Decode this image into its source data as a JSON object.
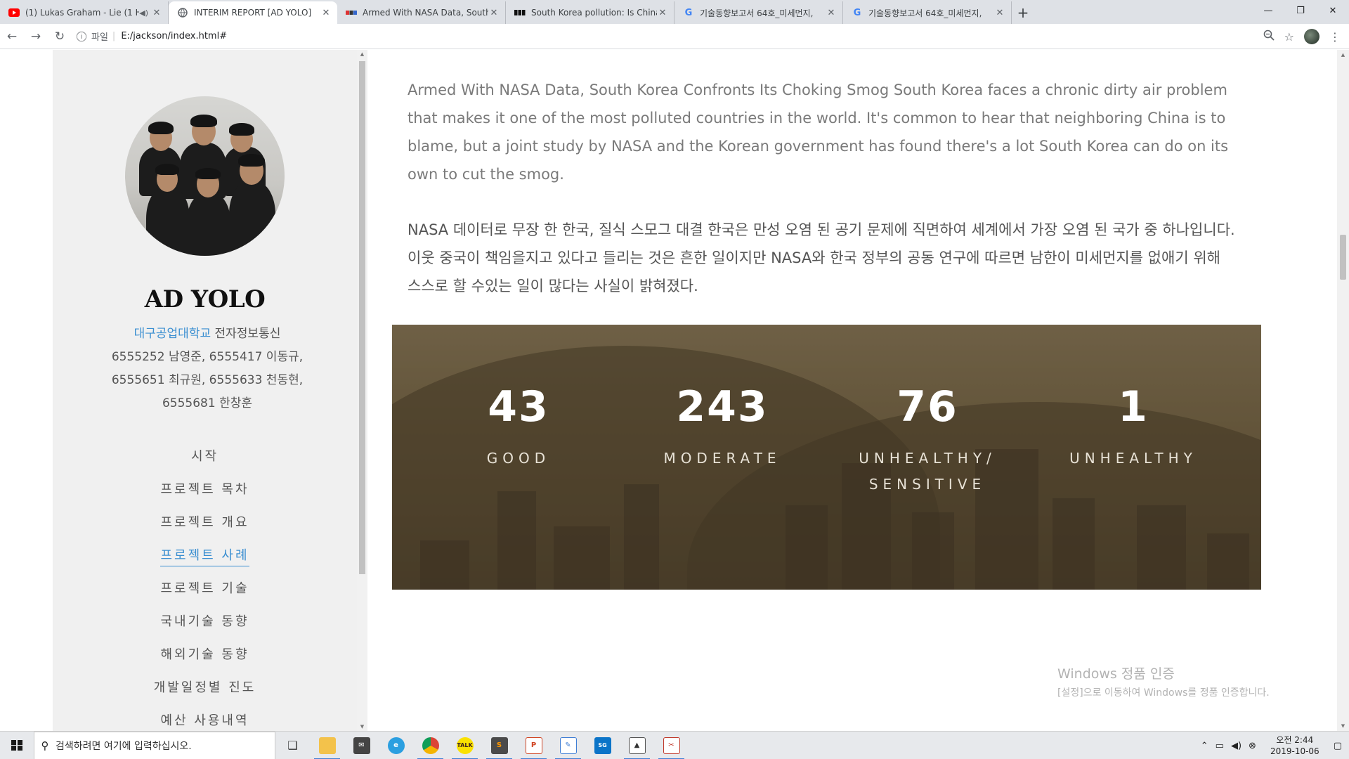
{
  "browser": {
    "tabs": [
      {
        "title": "(1) Lukas Graham - Lie (1 H",
        "icon": "youtube-icon",
        "active": false,
        "audio": true
      },
      {
        "title": "INTERIM REPORT [AD YOLO]",
        "icon": "globe-icon",
        "active": true,
        "audio": false
      },
      {
        "title": "Armed With NASA Data, South",
        "icon": "news-icon",
        "active": false,
        "audio": false
      },
      {
        "title": "South Korea pollution: Is China",
        "icon": "bbc-icon",
        "active": false,
        "audio": false
      },
      {
        "title": "기술동향보고서 64호_미세먼지,",
        "icon": "google-icon",
        "active": false,
        "audio": false
      },
      {
        "title": "기술동향보고서 64호_미세먼지,",
        "icon": "google-icon",
        "active": false,
        "audio": false
      }
    ],
    "address": {
      "scheme_label": "파일",
      "url": "E:/jackson/index.html#"
    }
  },
  "sidebar": {
    "brand": "AD YOLO",
    "school": "대구공업대학교",
    "department": " 전자정보통신",
    "members_line1": "6555252 남영준, 6555417 이동규,",
    "members_line2": "6555651 최규원, 6555633 천동현,",
    "members_line3": "6555681 한창훈",
    "menu": [
      {
        "label": "시작",
        "active": false
      },
      {
        "label": "프로젝트 목차",
        "active": false
      },
      {
        "label": "프로젝트 개요",
        "active": false
      },
      {
        "label": "프로젝트 사례",
        "active": true
      },
      {
        "label": "프로젝트 기술",
        "active": false
      },
      {
        "label": "국내기술 동향",
        "active": false
      },
      {
        "label": "해외기술 동향",
        "active": false
      },
      {
        "label": "개발일정별 진도",
        "active": false
      },
      {
        "label": "예산 사용내역",
        "active": false
      }
    ]
  },
  "main": {
    "paragraph_en": "Armed With NASA Data, South Korea Confronts Its Choking Smog South Korea faces a chronic dirty air problem that makes it one of the most polluted countries in the world. It's common to hear that neighboring China is to blame, but a joint study by NASA and the Korean government has found there's a lot South Korea can do on its own to cut the smog.",
    "paragraph_ko": "NASA 데이터로 무장 한 한국, 질식 스모그 대결 한국은 만성 오염 된 공기 문제에 직면하여 세계에서 가장 오염 된 국가 중 하나입니다. 이웃 중국이 책임을지고 있다고 들리는 것은 흔한 일이지만 NASA와 한국 정부의 공동 연구에 따르면 남한이 미세먼지를 없애기 위해 스스로 할 수있는 일이 많다는 사실이 밝혀졌다.",
    "stats": [
      {
        "value": "43",
        "label_line1": "GOOD",
        "label_line2": ""
      },
      {
        "value": "243",
        "label_line1": "MODERATE",
        "label_line2": ""
      },
      {
        "value": "76",
        "label_line1": "UNHEALTHY/",
        "label_line2": "SENSITIVE"
      },
      {
        "value": "1",
        "label_line1": "UNHEALTHY",
        "label_line2": ""
      }
    ]
  },
  "watermark": {
    "line1": "Windows 정품 인증",
    "line2": "[설정]으로 이동하여 Windows를 정품 인증합니다."
  },
  "taskbar": {
    "search_placeholder": "검색하려면 여기에 입력하십시오.",
    "clock_time": "오전 2:44",
    "clock_date": "2019-10-06"
  }
}
